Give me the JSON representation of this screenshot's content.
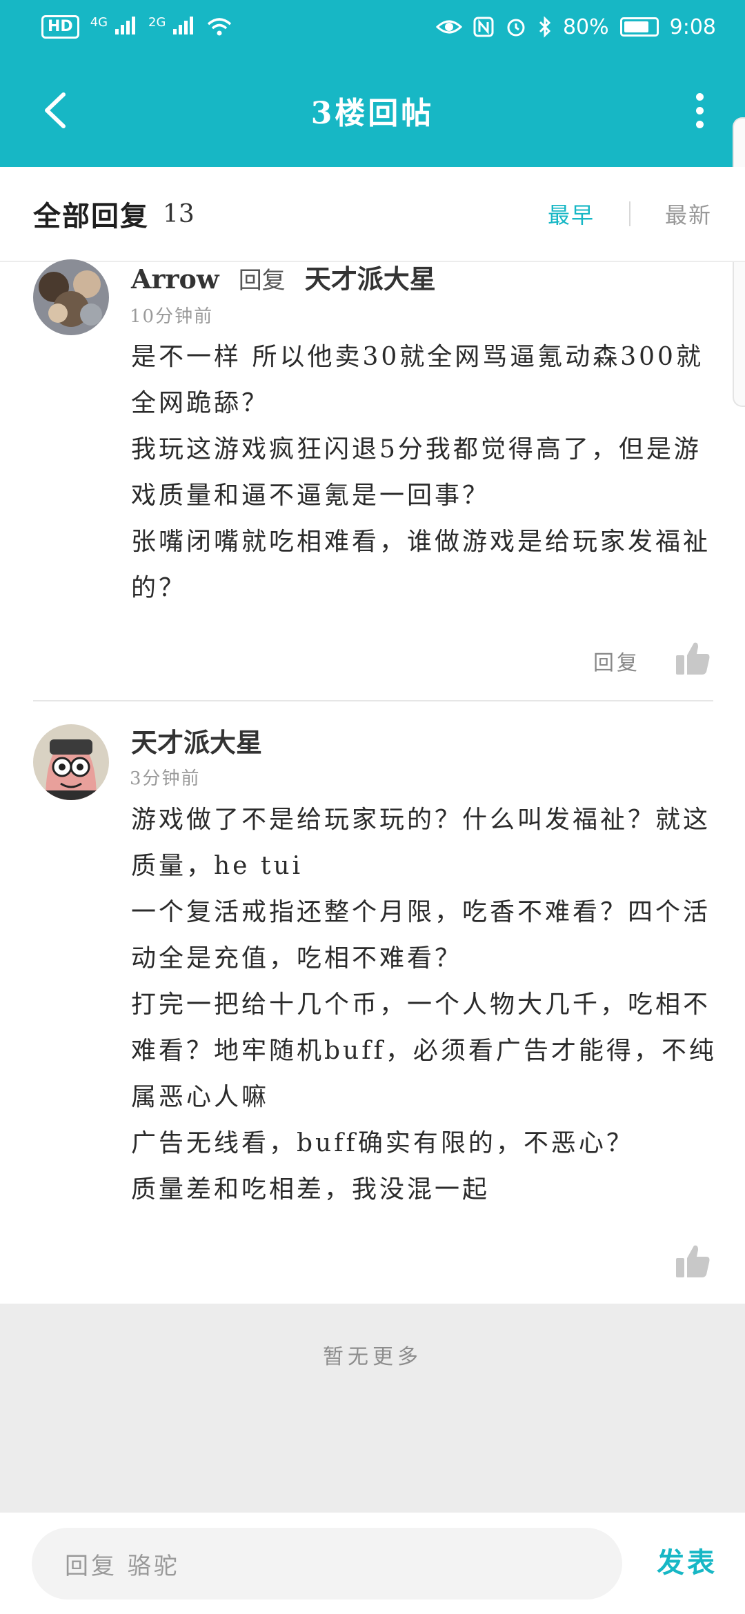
{
  "status_bar": {
    "hd": "HD",
    "sim1": "4G",
    "sim2": "2G",
    "battery": "80%",
    "battery_level": 0.8,
    "time": "9:08"
  },
  "header": {
    "title": "3楼回帖"
  },
  "replies": {
    "title": "全部回复",
    "count": "13",
    "sort_options": [
      "最早",
      "最新"
    ],
    "active_sort": "最早"
  },
  "posts": [
    {
      "author": "Arrow",
      "reply_word": "回复",
      "reply_to": "天才派大星",
      "time": "10分钟前",
      "lines": [
        "是不一样 所以他卖30就全网骂逼氪动森300就全网跪舔？",
        "我玩这游戏疯狂闪退5分我都觉得高了，但是游戏质量和逼不逼氪是一回事？",
        "张嘴闭嘴就吃相难看，谁做游戏是给玩家发福祉的？"
      ],
      "reply_label": "回复"
    },
    {
      "author": "天才派大星",
      "time": "3分钟前",
      "lines": [
        "游戏做了不是给玩家玩的？什么叫发福祉？就这质量，he tui",
        "一个复活戒指还整个月限，吃香不难看？四个活动全是充值，吃相不难看？",
        "打完一把给十几个币，一个人物大几千，吃相不难看？地牢随机buff，必须看广告才能得，不纯属恶心人嘛",
        "广告无线看，buff确实有限的，不恶心？",
        "质量差和吃相差，我没混一起"
      ]
    }
  ],
  "footer": {
    "no_more": "暂无更多",
    "input_placeholder": "回复 骆驼",
    "send_label": "发表"
  },
  "colors": {
    "accent": "#17b7c5",
    "muted": "#999999"
  }
}
